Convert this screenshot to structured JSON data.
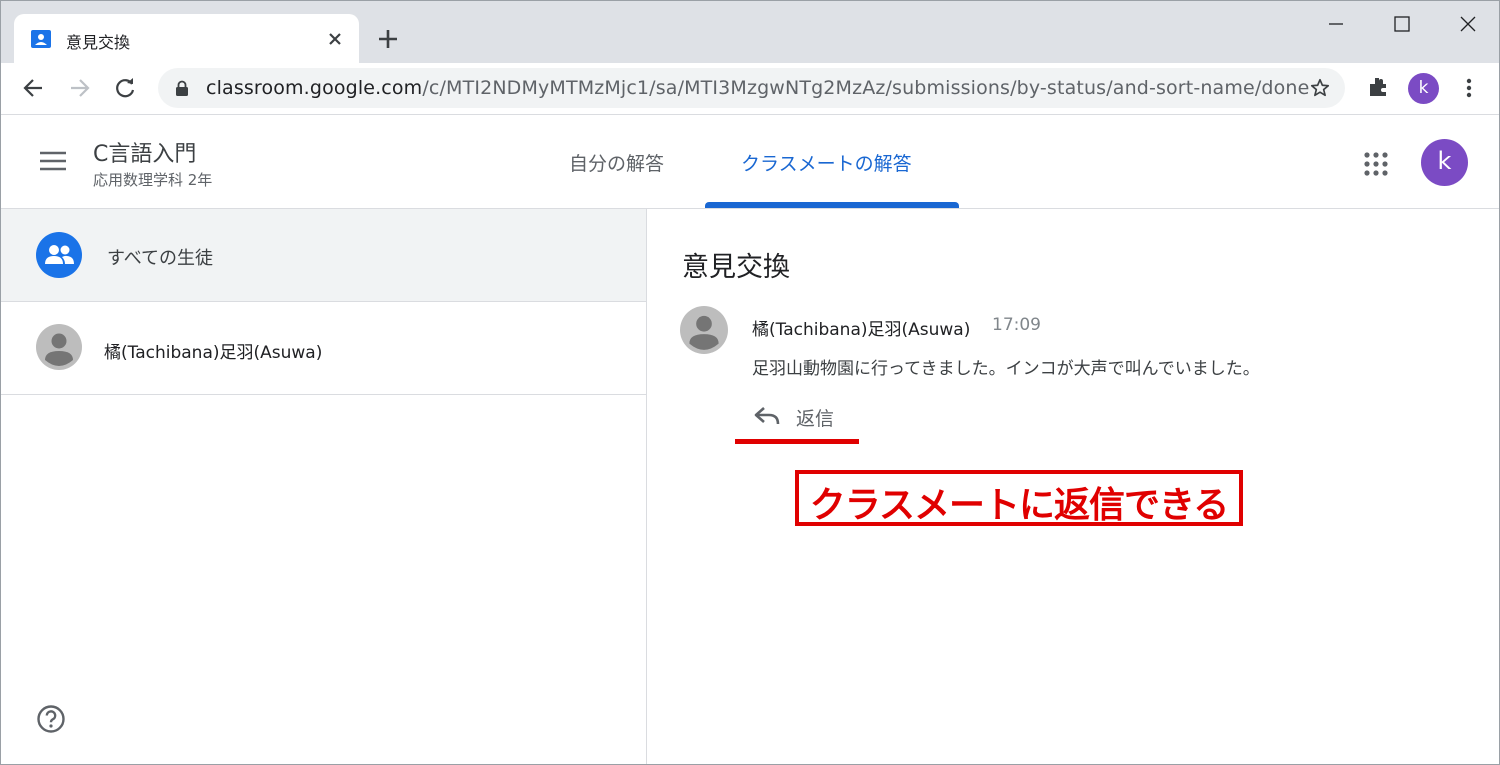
{
  "browser": {
    "tab_title": "意見交換",
    "url_host": "classroom.google.com",
    "url_path": "/c/MTI2NDMyMTMzMjc1/sa/MTI3MzgwNTg2MzAz/submissions/by-status/and-sort-name/done",
    "profile_initial": "k",
    "icons": [
      "classroom-favicon",
      "close-icon",
      "new-tab-icon",
      "minimize-icon",
      "maximize-icon",
      "window-close-icon",
      "back-icon",
      "forward-icon",
      "reload-icon",
      "lock-icon",
      "star-icon",
      "extensions-icon",
      "more-icon"
    ]
  },
  "header": {
    "course_name": "C言語入門",
    "course_section": "応用数理学科 2年",
    "tabs": [
      {
        "label": "自分の解答",
        "active": false
      },
      {
        "label": "クラスメートの解答",
        "active": true
      }
    ],
    "user_initial": "k",
    "accent_color": "#1967d2",
    "avatar_color": "#7b4bc4"
  },
  "sidebar": {
    "all_students_label": "すべての生徒",
    "students": [
      {
        "name": "橘(Tachibana)足羽(Asuwa)"
      }
    ]
  },
  "main": {
    "assignment_title": "意見交換",
    "post": {
      "author": "橘(Tachibana)足羽(Asuwa)",
      "time": "17:09",
      "body": "足羽山動物園に行ってきました。インコが大声で叫んでいました。",
      "reply_label": "返信"
    }
  },
  "annotation": {
    "callout_text": "クラスメートに返信できる",
    "color": "#e00000"
  }
}
